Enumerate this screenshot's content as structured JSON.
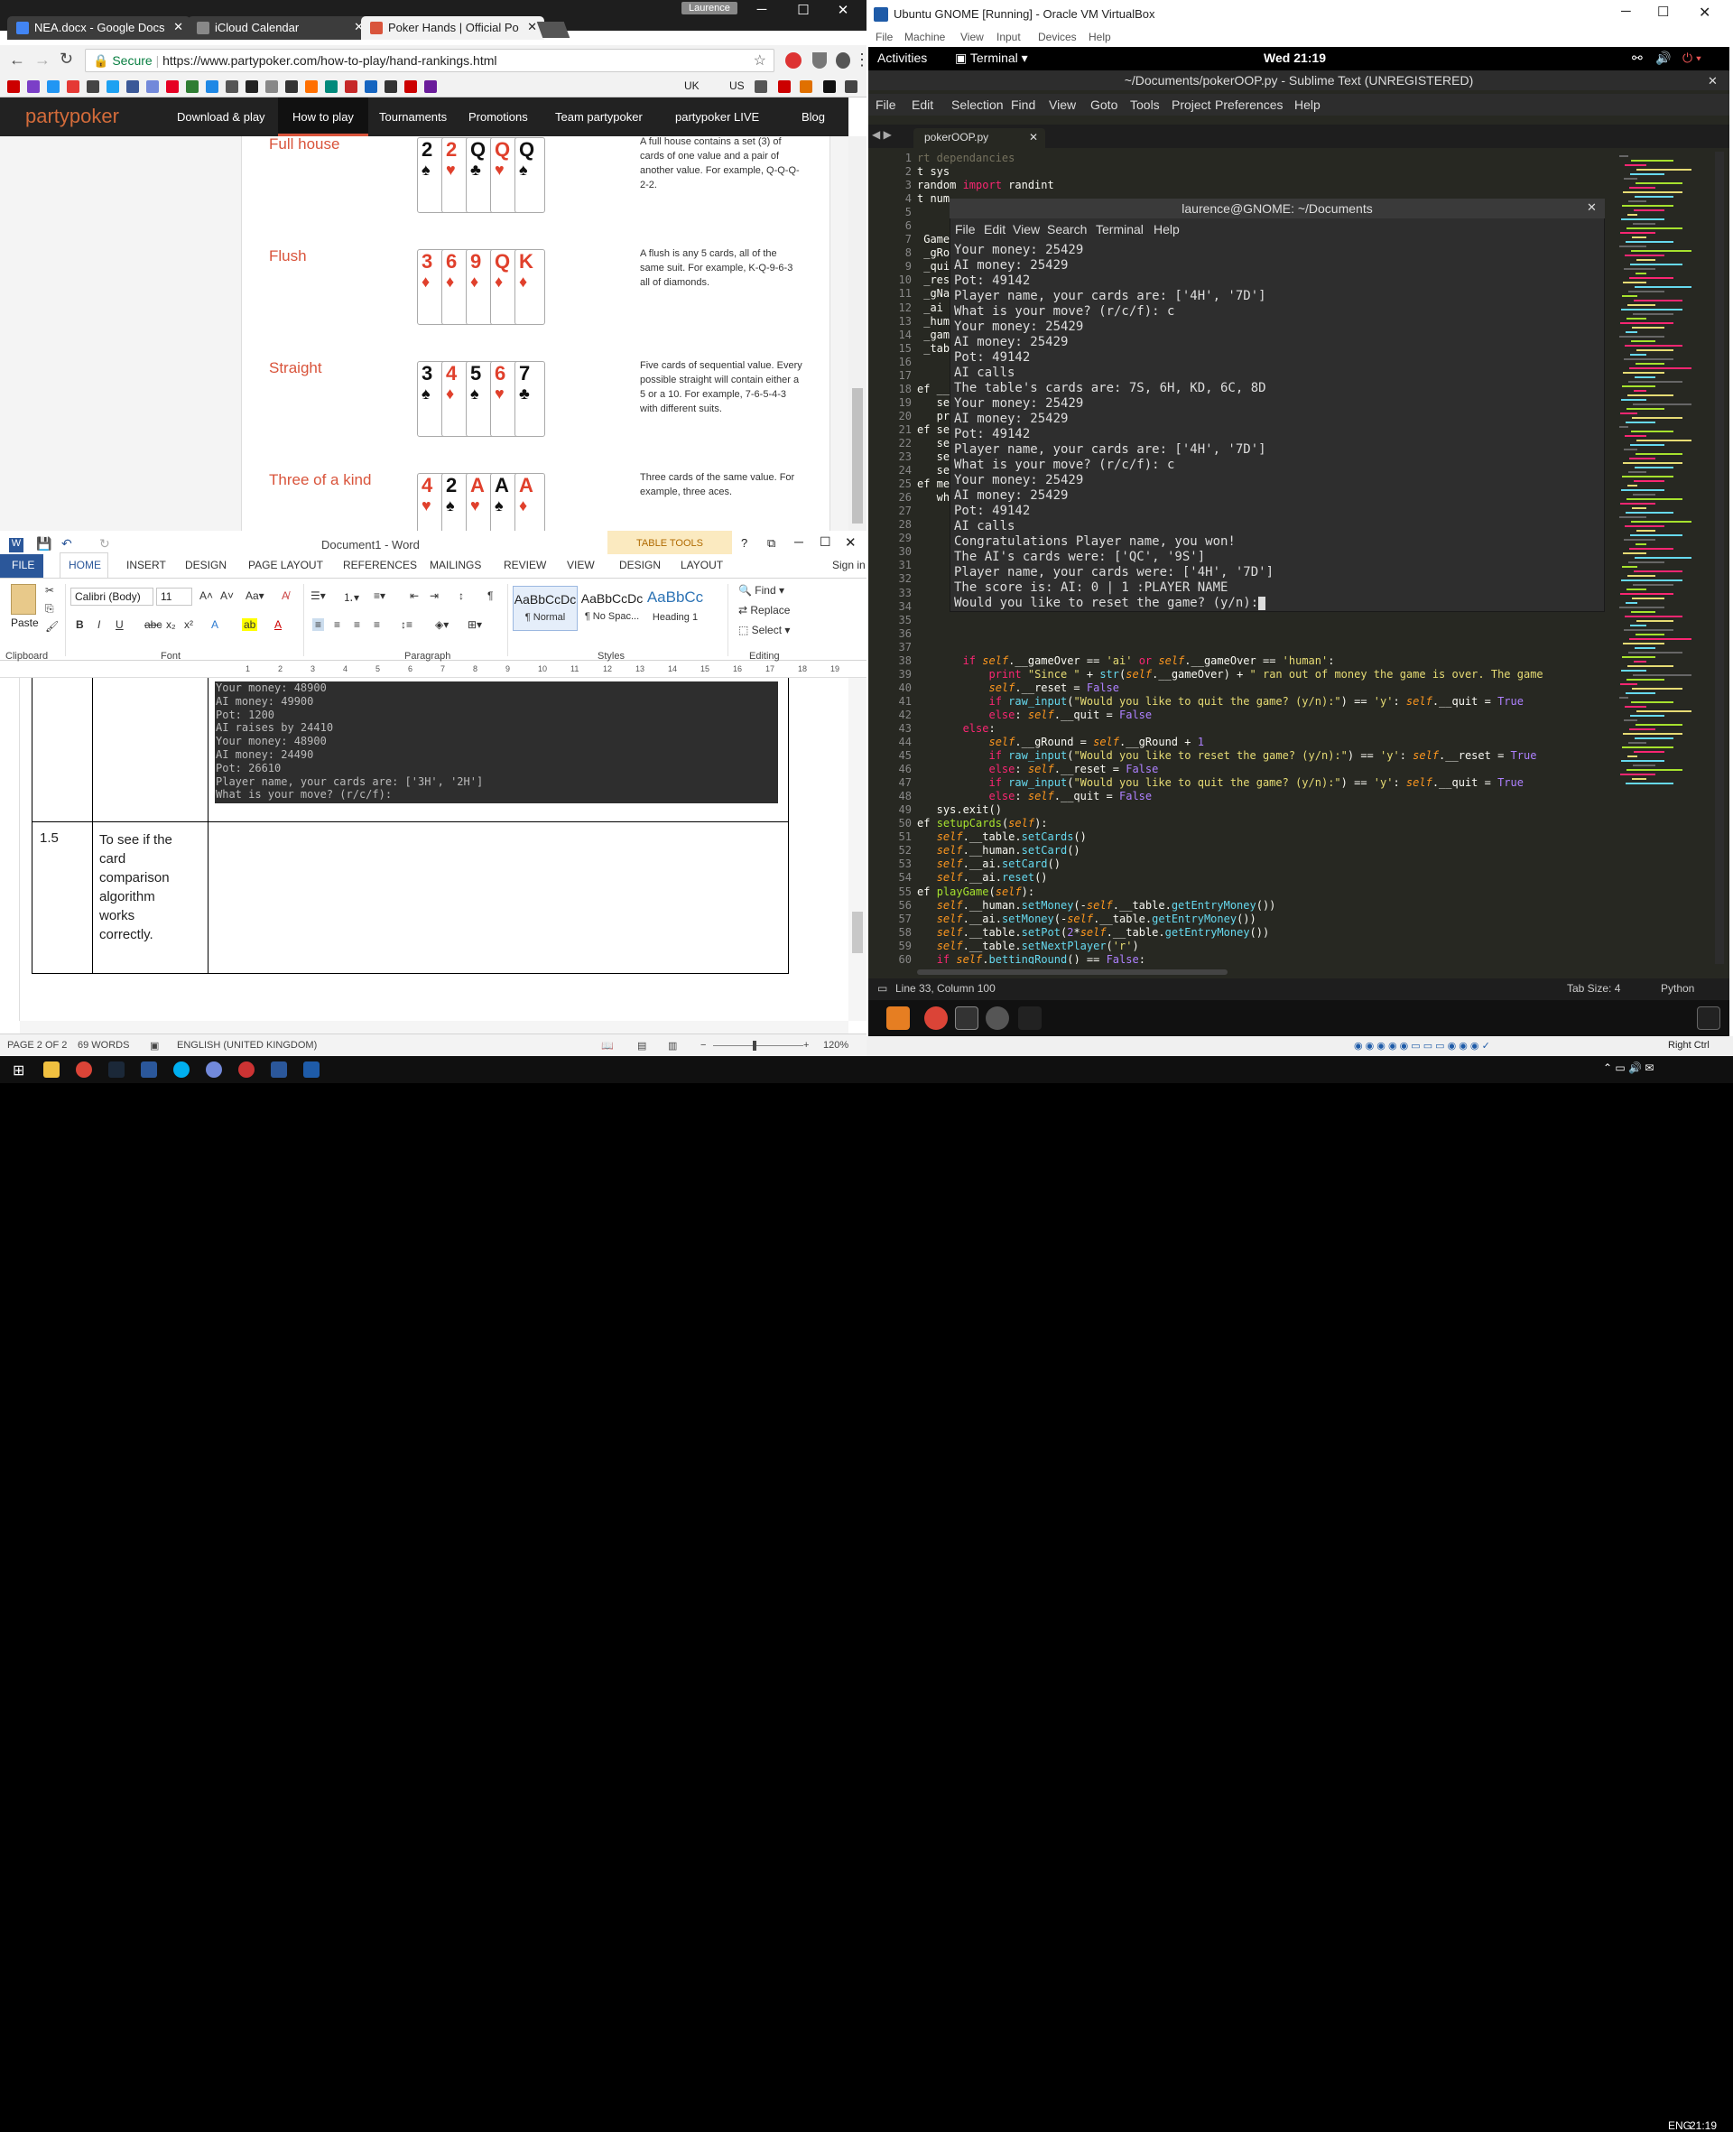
{
  "chrome": {
    "tabs": [
      {
        "label": "NEA.docx - Google Docs",
        "color": "#4285f4"
      },
      {
        "label": "iCloud Calendar",
        "color": "#888888"
      },
      {
        "label": "Poker Hands | Official Po",
        "color": "#d9543b"
      }
    ],
    "profile": "Laurence",
    "secure_label": "Secure",
    "url": "https://www.partypoker.com/how-to-play/hand-rankings.html",
    "bookmarks_text": [
      "UK",
      "US"
    ],
    "site": {
      "logo": "partypoker",
      "nav": [
        "Download & play",
        "How to play",
        "Tournaments",
        "Promotions",
        "Team partypoker",
        "partypoker LIVE",
        "Blog"
      ],
      "hands": [
        {
          "title": "Full house",
          "desc": "A full house contains a set (3) of cards of one value and a pair of another value. For example, Q-Q-Q-2-2.",
          "cards": [
            [
              "2",
              "♠",
              "blk"
            ],
            [
              "2",
              "♥",
              "red"
            ],
            [
              "Q",
              "♣",
              "blk"
            ],
            [
              "Q",
              "♥",
              "red"
            ],
            [
              "Q",
              "♠",
              "blk"
            ]
          ]
        },
        {
          "title": "Flush",
          "desc": "A flush is any 5 cards, all of the same suit. For example, K-Q-9-6-3 all of diamonds.",
          "cards": [
            [
              "3",
              "♦",
              "red"
            ],
            [
              "6",
              "♦",
              "red"
            ],
            [
              "9",
              "♦",
              "red"
            ],
            [
              "Q",
              "♦",
              "red"
            ],
            [
              "K",
              "♦",
              "red"
            ]
          ]
        },
        {
          "title": "Straight",
          "desc": "Five cards of sequential value. Every possible straight will contain either a 5 or a 10. For example, 7-6-5-4-3 with different suits.",
          "cards": [
            [
              "3",
              "♠",
              "blk"
            ],
            [
              "4",
              "♦",
              "red"
            ],
            [
              "5",
              "♠",
              "blk"
            ],
            [
              "6",
              "♥",
              "red"
            ],
            [
              "7",
              "♣",
              "blk"
            ]
          ]
        },
        {
          "title": "Three of a kind",
          "desc": "Three cards of the same value. For example, three aces.",
          "cards": [
            [
              "4",
              "♥",
              "red"
            ],
            [
              "2",
              "♠",
              "blk"
            ],
            [
              "A",
              "♥",
              "red"
            ],
            [
              "A",
              "♠",
              "blk"
            ],
            [
              "A",
              "♦",
              "red"
            ]
          ]
        }
      ]
    }
  },
  "word": {
    "title": "Document1 - Word",
    "table_tools": "TABLE TOOLS",
    "tabs": [
      "FILE",
      "HOME",
      "INSERT",
      "DESIGN",
      "PAGE LAYOUT",
      "REFERENCES",
      "MAILINGS",
      "REVIEW",
      "VIEW",
      "DESIGN",
      "LAYOUT"
    ],
    "sign_in": "Sign in",
    "ribbon": {
      "paste": "Paste",
      "font": "Calibri (Body)",
      "size": "11",
      "groups": [
        "Clipboard",
        "Font",
        "Paragraph",
        "Styles",
        "Editing"
      ],
      "styles": [
        {
          "preview": "AaBbCcDc",
          "name": "¶ Normal"
        },
        {
          "preview": "AaBbCcDc",
          "name": "¶ No Spac..."
        },
        {
          "preview": "AaBbCc",
          "name": "Heading 1"
        }
      ],
      "editing": [
        "Find",
        "Replace",
        "Select"
      ]
    },
    "terminal_capture": [
      "Your money: 48900",
      "AI money: 49900",
      "Pot: 1200",
      "AI raises by 24410",
      "Your money: 48900",
      "AI money: 24490",
      "Pot: 26610",
      "Player name, your cards are: ['3H', '2H']",
      "What is your move? (r/c/f):"
    ],
    "row": {
      "num": "1.5",
      "text": "To see if the card comparison algorithm works correctly."
    },
    "status": {
      "page": "PAGE 2 OF 2",
      "words": "69 WORDS",
      "lang": "ENGLISH (UNITED KINGDOM)",
      "zoom": "120%"
    }
  },
  "vbox": {
    "title": "Ubuntu GNOME [Running] - Oracle VM VirtualBox",
    "menu": [
      "File",
      "Machine",
      "View",
      "Input",
      "Devices",
      "Help"
    ],
    "gnome": {
      "activities": "Activities",
      "app": "Terminal",
      "clock": "Wed 21:19"
    },
    "sublime": {
      "title": "~/Documents/pokerOOP.py - Sublime Text (UNREGISTERED)",
      "menu": [
        "File",
        "Edit",
        "Selection",
        "Find",
        "View",
        "Goto",
        "Tools",
        "Project",
        "Preferences",
        "Help"
      ],
      "tab": "pokerOOP.py",
      "status": {
        "pos": "Line 33, Column 100",
        "tabsize": "Tab Size: 4",
        "syntax": "Python"
      }
    },
    "terminal": {
      "title": "laurence@GNOME: ~/Documents",
      "menu": [
        "File",
        "Edit",
        "View",
        "Search",
        "Terminal",
        "Help"
      ],
      "lines": [
        "Your money: 25429",
        "AI money: 25429",
        "Pot: 49142",
        "Player name, your cards are: ['4H', '7D']",
        "What is your move? (r/c/f): c",
        "Your money: 25429",
        "AI money: 25429",
        "Pot: 49142",
        "AI calls",
        "The table's cards are: 7S, 6H, KD, 6C, 8D",
        "Your money: 25429",
        "AI money: 25429",
        "Pot: 49142",
        "Player name, your cards are: ['4H', '7D']",
        "What is your move? (r/c/f): c",
        "Your money: 25429",
        "AI money: 25429",
        "Pot: 49142",
        "AI calls",
        "Congratulations Player name, you won!",
        "The AI's cards were: ['QC', '9S']",
        "Player name, your cards were: ['4H', '7D']",
        "The score is: AI: 0 | 1 :PLAYER NAME",
        "Would you like to reset the game? (y/n):"
      ]
    },
    "host_key": "Right Ctrl"
  },
  "taskbar": {
    "lang": "ENG",
    "clock": "21:19"
  }
}
